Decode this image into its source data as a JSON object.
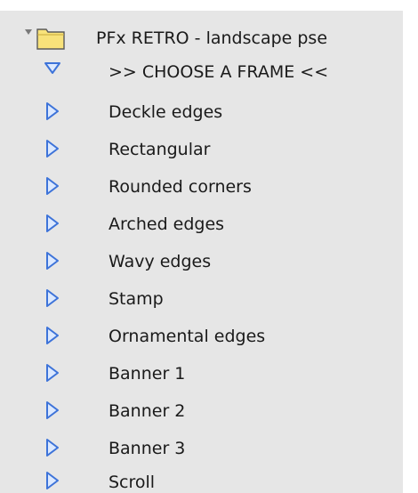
{
  "colors": {
    "list_background": "#e6e6e6",
    "triangle_stroke": "#3d73d9",
    "triangle_fill": "#dce9ff",
    "folder_fill": "#f8e27a",
    "folder_stroke": "#5a5a5a"
  },
  "tree": {
    "group": {
      "label": "PFx RETRO - landscape pse",
      "expanded": true,
      "icon": "folder-icon"
    },
    "items": [
      {
        "label": ">> CHOOSE A FRAME <<",
        "expanded": true,
        "icon": "triangle-down-icon"
      },
      {
        "label": "Deckle edges",
        "expanded": false,
        "icon": "triangle-right-icon"
      },
      {
        "label": "Rectangular",
        "expanded": false,
        "icon": "triangle-right-icon"
      },
      {
        "label": "Rounded corners",
        "expanded": false,
        "icon": "triangle-right-icon"
      },
      {
        "label": "Arched edges",
        "expanded": false,
        "icon": "triangle-right-icon"
      },
      {
        "label": "Wavy edges",
        "expanded": false,
        "icon": "triangle-right-icon"
      },
      {
        "label": "Stamp",
        "expanded": false,
        "icon": "triangle-right-icon"
      },
      {
        "label": "Ornamental edges",
        "expanded": false,
        "icon": "triangle-right-icon"
      },
      {
        "label": "Banner 1",
        "expanded": false,
        "icon": "triangle-right-icon"
      },
      {
        "label": "Banner 2",
        "expanded": false,
        "icon": "triangle-right-icon"
      },
      {
        "label": "Banner 3",
        "expanded": false,
        "icon": "triangle-right-icon"
      },
      {
        "label": "Scroll",
        "expanded": false,
        "icon": "triangle-right-icon"
      }
    ]
  }
}
